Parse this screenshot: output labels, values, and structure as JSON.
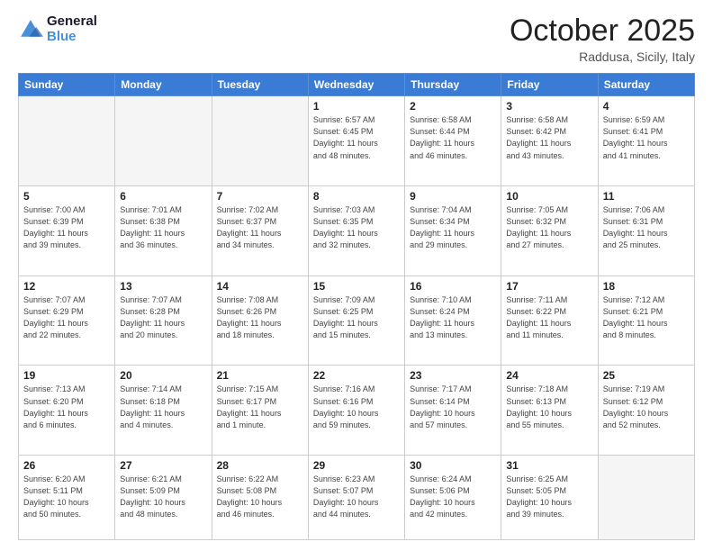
{
  "header": {
    "logo_general": "General",
    "logo_blue": "Blue",
    "month": "October 2025",
    "location": "Raddusa, Sicily, Italy"
  },
  "days_of_week": [
    "Sunday",
    "Monday",
    "Tuesday",
    "Wednesday",
    "Thursday",
    "Friday",
    "Saturday"
  ],
  "weeks": [
    [
      {
        "day": "",
        "info": ""
      },
      {
        "day": "",
        "info": ""
      },
      {
        "day": "",
        "info": ""
      },
      {
        "day": "1",
        "info": "Sunrise: 6:57 AM\nSunset: 6:45 PM\nDaylight: 11 hours\nand 48 minutes."
      },
      {
        "day": "2",
        "info": "Sunrise: 6:58 AM\nSunset: 6:44 PM\nDaylight: 11 hours\nand 46 minutes."
      },
      {
        "day": "3",
        "info": "Sunrise: 6:58 AM\nSunset: 6:42 PM\nDaylight: 11 hours\nand 43 minutes."
      },
      {
        "day": "4",
        "info": "Sunrise: 6:59 AM\nSunset: 6:41 PM\nDaylight: 11 hours\nand 41 minutes."
      }
    ],
    [
      {
        "day": "5",
        "info": "Sunrise: 7:00 AM\nSunset: 6:39 PM\nDaylight: 11 hours\nand 39 minutes."
      },
      {
        "day": "6",
        "info": "Sunrise: 7:01 AM\nSunset: 6:38 PM\nDaylight: 11 hours\nand 36 minutes."
      },
      {
        "day": "7",
        "info": "Sunrise: 7:02 AM\nSunset: 6:37 PM\nDaylight: 11 hours\nand 34 minutes."
      },
      {
        "day": "8",
        "info": "Sunrise: 7:03 AM\nSunset: 6:35 PM\nDaylight: 11 hours\nand 32 minutes."
      },
      {
        "day": "9",
        "info": "Sunrise: 7:04 AM\nSunset: 6:34 PM\nDaylight: 11 hours\nand 29 minutes."
      },
      {
        "day": "10",
        "info": "Sunrise: 7:05 AM\nSunset: 6:32 PM\nDaylight: 11 hours\nand 27 minutes."
      },
      {
        "day": "11",
        "info": "Sunrise: 7:06 AM\nSunset: 6:31 PM\nDaylight: 11 hours\nand 25 minutes."
      }
    ],
    [
      {
        "day": "12",
        "info": "Sunrise: 7:07 AM\nSunset: 6:29 PM\nDaylight: 11 hours\nand 22 minutes."
      },
      {
        "day": "13",
        "info": "Sunrise: 7:07 AM\nSunset: 6:28 PM\nDaylight: 11 hours\nand 20 minutes."
      },
      {
        "day": "14",
        "info": "Sunrise: 7:08 AM\nSunset: 6:26 PM\nDaylight: 11 hours\nand 18 minutes."
      },
      {
        "day": "15",
        "info": "Sunrise: 7:09 AM\nSunset: 6:25 PM\nDaylight: 11 hours\nand 15 minutes."
      },
      {
        "day": "16",
        "info": "Sunrise: 7:10 AM\nSunset: 6:24 PM\nDaylight: 11 hours\nand 13 minutes."
      },
      {
        "day": "17",
        "info": "Sunrise: 7:11 AM\nSunset: 6:22 PM\nDaylight: 11 hours\nand 11 minutes."
      },
      {
        "day": "18",
        "info": "Sunrise: 7:12 AM\nSunset: 6:21 PM\nDaylight: 11 hours\nand 8 minutes."
      }
    ],
    [
      {
        "day": "19",
        "info": "Sunrise: 7:13 AM\nSunset: 6:20 PM\nDaylight: 11 hours\nand 6 minutes."
      },
      {
        "day": "20",
        "info": "Sunrise: 7:14 AM\nSunset: 6:18 PM\nDaylight: 11 hours\nand 4 minutes."
      },
      {
        "day": "21",
        "info": "Sunrise: 7:15 AM\nSunset: 6:17 PM\nDaylight: 11 hours\nand 1 minute."
      },
      {
        "day": "22",
        "info": "Sunrise: 7:16 AM\nSunset: 6:16 PM\nDaylight: 10 hours\nand 59 minutes."
      },
      {
        "day": "23",
        "info": "Sunrise: 7:17 AM\nSunset: 6:14 PM\nDaylight: 10 hours\nand 57 minutes."
      },
      {
        "day": "24",
        "info": "Sunrise: 7:18 AM\nSunset: 6:13 PM\nDaylight: 10 hours\nand 55 minutes."
      },
      {
        "day": "25",
        "info": "Sunrise: 7:19 AM\nSunset: 6:12 PM\nDaylight: 10 hours\nand 52 minutes."
      }
    ],
    [
      {
        "day": "26",
        "info": "Sunrise: 6:20 AM\nSunset: 5:11 PM\nDaylight: 10 hours\nand 50 minutes."
      },
      {
        "day": "27",
        "info": "Sunrise: 6:21 AM\nSunset: 5:09 PM\nDaylight: 10 hours\nand 48 minutes."
      },
      {
        "day": "28",
        "info": "Sunrise: 6:22 AM\nSunset: 5:08 PM\nDaylight: 10 hours\nand 46 minutes."
      },
      {
        "day": "29",
        "info": "Sunrise: 6:23 AM\nSunset: 5:07 PM\nDaylight: 10 hours\nand 44 minutes."
      },
      {
        "day": "30",
        "info": "Sunrise: 6:24 AM\nSunset: 5:06 PM\nDaylight: 10 hours\nand 42 minutes."
      },
      {
        "day": "31",
        "info": "Sunrise: 6:25 AM\nSunset: 5:05 PM\nDaylight: 10 hours\nand 39 minutes."
      },
      {
        "day": "",
        "info": ""
      }
    ]
  ]
}
